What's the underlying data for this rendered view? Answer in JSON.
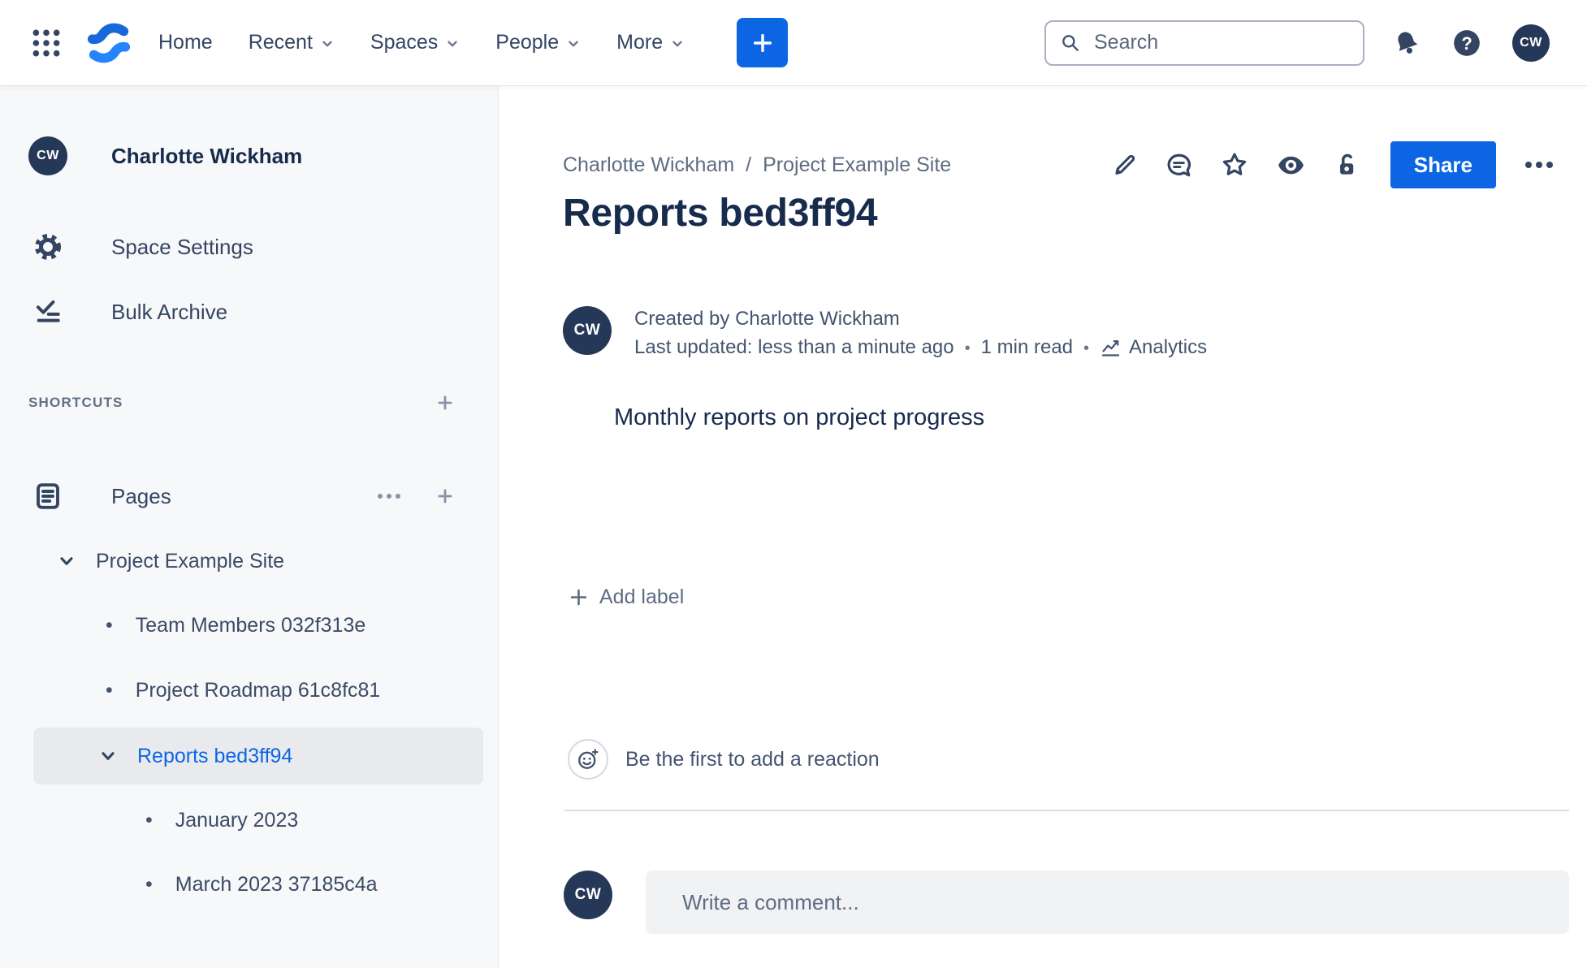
{
  "topnav": {
    "menu": [
      "Home",
      "Recent",
      "Spaces",
      "People",
      "More"
    ],
    "search_placeholder": "Search",
    "avatar_initials": "CW"
  },
  "sidebar": {
    "profile_initials": "CW",
    "profile_name": "Charlotte Wickham",
    "space_settings_label": "Space Settings",
    "bulk_archive_label": "Bulk Archive",
    "shortcuts_label": "SHORTCUTS",
    "pages_label": "Pages",
    "tree": {
      "root_label": "Project Example Site",
      "child_1": "Team Members 032f313e",
      "child_2": "Project Roadmap 61c8fc81",
      "selected_label": "Reports bed3ff94",
      "grandchild_1": "January 2023",
      "grandchild_2": "March 2023 37185c4a"
    }
  },
  "content": {
    "breadcrumb_1": "Charlotte Wickham",
    "breadcrumb_2": "Project Example Site",
    "share_label": "Share",
    "title": "Reports bed3ff94",
    "created_by": "Created by Charlotte Wickham",
    "last_updated": "Last updated: less than a minute ago",
    "read_time": "1 min read",
    "analytics_label": "Analytics",
    "body_text": "Monthly reports on project progress",
    "add_label_text": "Add label",
    "reaction_prompt": "Be the first to add a reaction",
    "comment_avatar_initials": "CW",
    "comment_placeholder": "Write a comment..."
  },
  "colors": {
    "brand_blue": "#0C66E4",
    "dark_text": "#172B4D",
    "nav_icon": "#344563",
    "muted_text": "#626F86",
    "sidebar_bg": "#F7F8F9",
    "selected_row_bg": "#E9EAED",
    "avatar_bg": "#253858"
  }
}
